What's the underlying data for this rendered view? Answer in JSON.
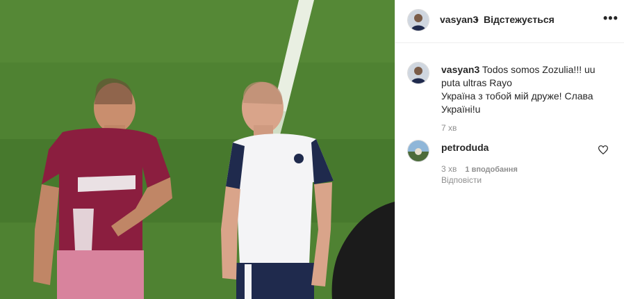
{
  "post": {
    "author": "vasyan3",
    "separator": "•",
    "follow_status": "Відстежується",
    "more_icon": "more-horizontal-icon"
  },
  "comments": [
    {
      "username": "vasyan3",
      "lines": [
        "Todos somos Zozulia!!! u⁣u⁣",
        "puta ultras Rayo⁣",
        "Україна з тобой мій друже! Слава",
        "Україні!u⁣"
      ],
      "first_line_text": "Todos somos Zozulia!!! u⁣u⁣",
      "time": "7 хв"
    },
    {
      "username": "petroduda",
      "text": "⁣⁣⁣",
      "time": "3 хв",
      "likes": "1 вподобання",
      "reply_label": "Відповісти",
      "like_icon": "heart-icon"
    }
  ],
  "colors": {
    "pitch": "#4d7f2f",
    "maroon_kit": "#8b1e3f",
    "navy_white_kit": "#1f2a4d"
  }
}
